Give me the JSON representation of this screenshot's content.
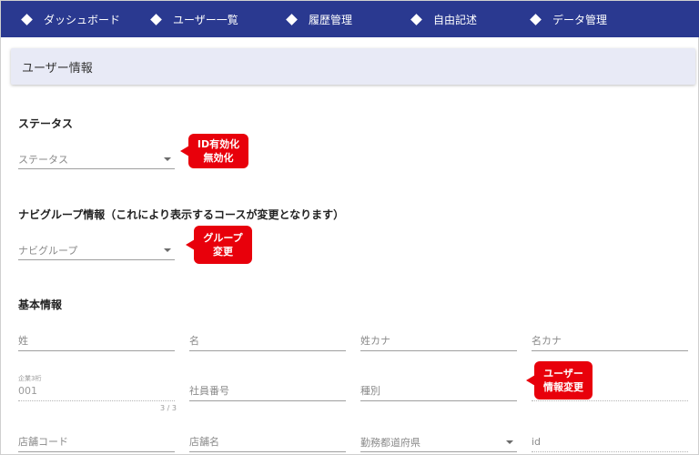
{
  "nav": {
    "items": [
      {
        "label": "ダッシュボード"
      },
      {
        "label": "ユーザー一覧"
      },
      {
        "label": "履歴管理"
      },
      {
        "label": "自由記述"
      },
      {
        "label": "データ管理"
      }
    ]
  },
  "header": {
    "title": "ユーザー情報"
  },
  "status_section": {
    "title": "ステータス",
    "select_placeholder": "ステータス",
    "callout_line1": "ID有効化",
    "callout_line2": "無効化"
  },
  "navi_group_section": {
    "title": "ナビグループ情報（これにより表示するコースが変更となります）",
    "select_placeholder": "ナビグループ",
    "callout_line1": "グループ",
    "callout_line2": "変更"
  },
  "basic_info": {
    "title": "基本情報",
    "last_name_placeholder": "姓",
    "first_name_placeholder": "名",
    "last_name_kana_placeholder": "姓カナ",
    "first_name_kana_placeholder": "名カナ",
    "company_label": "企業3桁",
    "company_value": "001",
    "company_counter": "3 / 3",
    "employee_number_placeholder": "社員番号",
    "type_placeholder": "種別",
    "store_code_placeholder": "店舗コード",
    "store_name_placeholder": "店舗名",
    "prefecture_placeholder": "勤務都道府県",
    "id_placeholder": "id",
    "callout_line1": "ユーザー",
    "callout_line2": "情報変更"
  },
  "colors": {
    "navbar": "#2a3990",
    "callout": "#e8000b",
    "header_card": "#e8eaf6"
  }
}
